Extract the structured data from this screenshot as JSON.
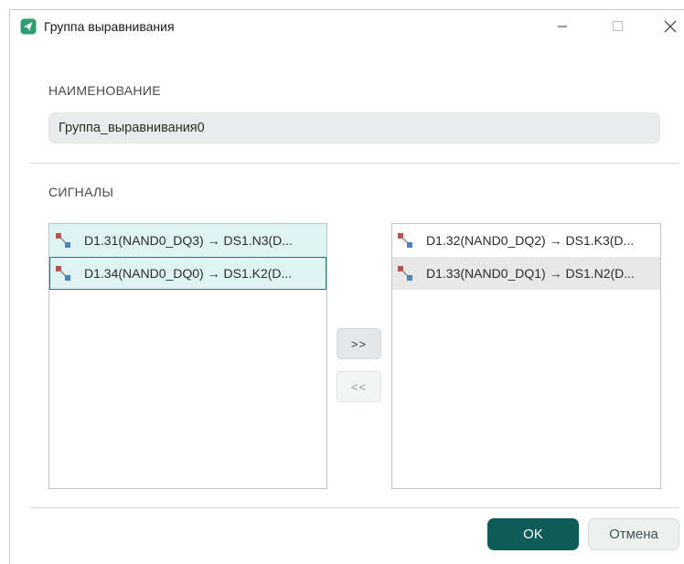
{
  "window": {
    "title": "Группа выравнивания",
    "app_icon": "app-logo-icon",
    "controls": [
      "minimize-icon",
      "maximize-icon",
      "close-icon"
    ]
  },
  "name_section": {
    "label": "НАИМЕНОВАНИЕ",
    "value": "Группа_выравнивания0"
  },
  "signals_section": {
    "label": "СИГНАЛЫ",
    "left_list": [
      {
        "label": "D1.31(NAND0_DQ3) → DS1.N3(D...",
        "icon": "signal-icon",
        "state": "selected"
      },
      {
        "label": "D1.34(NAND0_DQ0) → DS1.K2(D...",
        "icon": "signal-icon",
        "state": "focused"
      }
    ],
    "right_list": [
      {
        "label": "D1.32(NAND0_DQ2) → DS1.K3(D...",
        "icon": "signal-icon",
        "state": "normal"
      },
      {
        "label": "D1.33(NAND0_DQ1) → DS1.N2(D...",
        "icon": "signal-icon",
        "state": "highlighted"
      }
    ],
    "add_button": ">>",
    "remove_button": "<<"
  },
  "footer": {
    "ok": "OK",
    "cancel": "Отмена"
  },
  "colors": {
    "accent": "#0d5c5a",
    "selection": "#dff3f2",
    "focus_border": "#1f7b78",
    "input_bg": "#e9ecec",
    "signal_red": "#c0504d",
    "signal_blue": "#4f81bd"
  }
}
